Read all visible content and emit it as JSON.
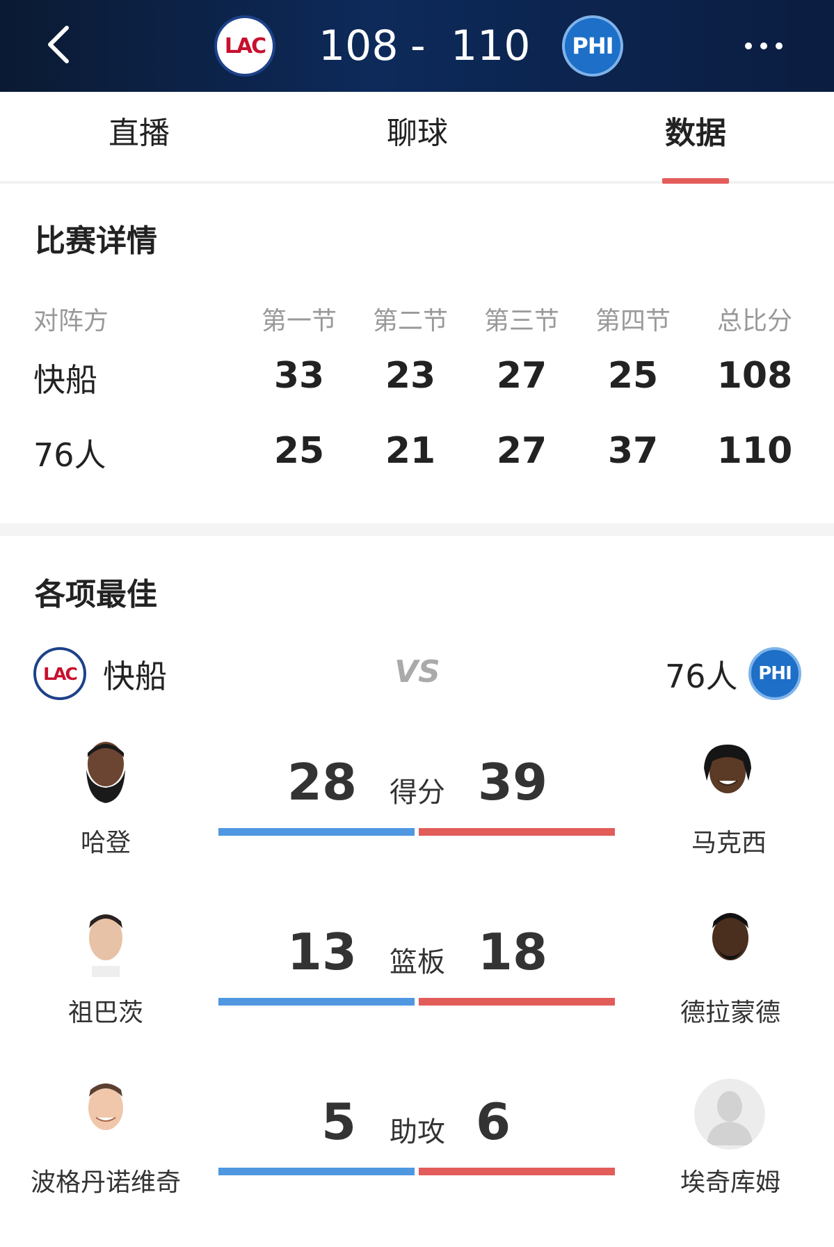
{
  "header": {
    "home_logo": "LAC",
    "away_logo": "PHI",
    "home_score": "108",
    "separator": "-",
    "away_score": "110",
    "back_icon": "chevron-left-icon",
    "more_icon": "more-horizontal-icon"
  },
  "tabs": [
    {
      "label": "直播"
    },
    {
      "label": "聊球"
    },
    {
      "label": "数据",
      "active": true
    }
  ],
  "match_details": {
    "title": "比赛详情",
    "headers": [
      "对阵方",
      "第一节",
      "第二节",
      "第三节",
      "第四节",
      "总比分"
    ],
    "rows": [
      {
        "team": "快船",
        "q1": "33",
        "q2": "23",
        "q3": "27",
        "q4": "25",
        "total": "108"
      },
      {
        "team": "76人",
        "q1": "25",
        "q2": "21",
        "q3": "27",
        "q4": "37",
        "total": "110"
      }
    ]
  },
  "leaders": {
    "title": "各项最佳",
    "home_team": "快船",
    "home_logo": "LAC",
    "vs": "VS",
    "away_team": "76人",
    "away_logo": "PHI",
    "stats": [
      {
        "label": "得分",
        "home_player": "哈登",
        "home_value": "28",
        "away_player": "马克西",
        "away_value": "39"
      },
      {
        "label": "篮板",
        "home_player": "祖巴茨",
        "home_value": "13",
        "away_player": "德拉蒙德",
        "away_value": "18"
      },
      {
        "label": "助攻",
        "home_player": "波格丹诺维奇",
        "home_value": "5",
        "away_player": "埃奇库姆",
        "away_value": "6"
      }
    ]
  },
  "colors": {
    "header_bg": "#0d2a5a",
    "tab_accent": "#e35d5b",
    "home_bar": "#4f97e0",
    "away_bar": "#e25c59"
  }
}
